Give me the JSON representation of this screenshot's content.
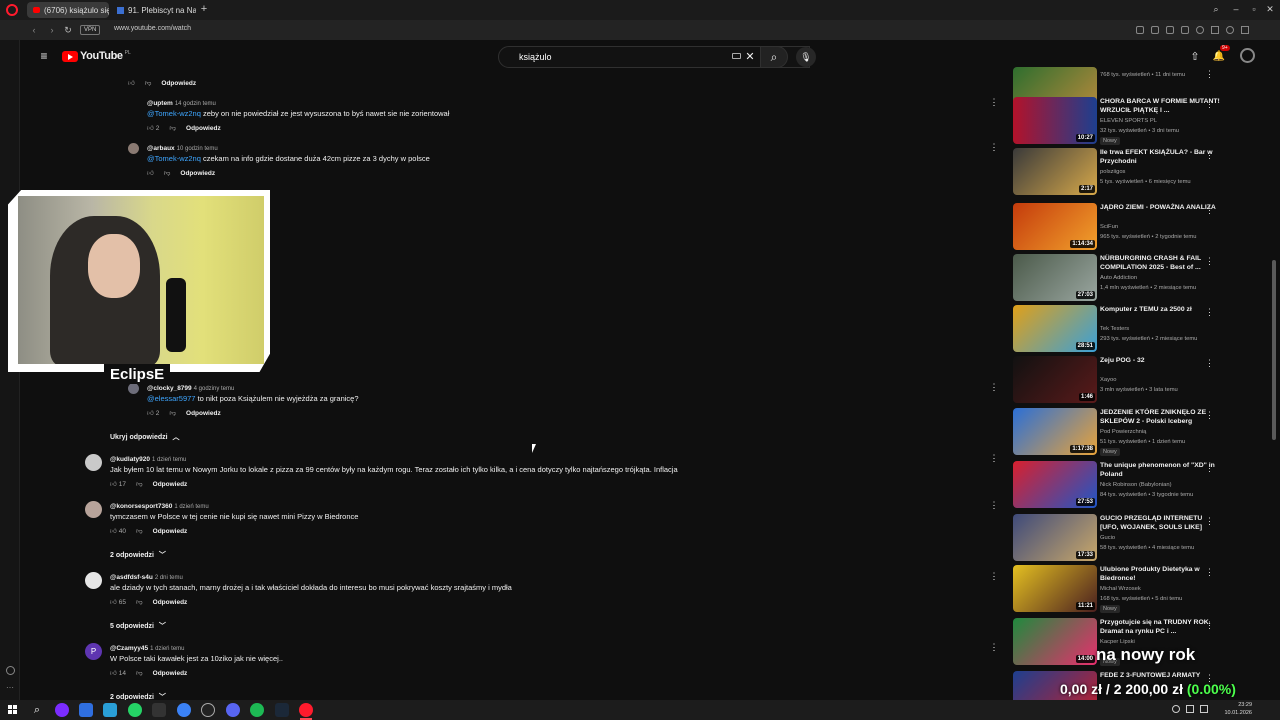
{
  "browser": {
    "tabs": [
      {
        "label": "(6706) książulo się cieszy"
      },
      {
        "label": "91. Plebiscyt na Najlepsze"
      }
    ],
    "vpn": "VPN",
    "url": "www.youtube.com/watch"
  },
  "youtube": {
    "logo": "YouTube",
    "region": "PL",
    "search_value": "książulo",
    "notif_count": "9+"
  },
  "comments": {
    "replies_top": [
      {
        "author": "",
        "time": "",
        "text": "",
        "likes": "",
        "reply": "Odpowiedz"
      },
      {
        "author": "@uptem",
        "time": "14 godzin temu",
        "mention": "@Tomek-wz2nq",
        "text": "zeby on nie powiedział ze jest wysuszona to byś nawet sie nie zorientował",
        "likes": "2",
        "reply": "Odpowiedz"
      },
      {
        "author": "@arbaux",
        "time": "10 godzin temu",
        "mention": "@Tomek-wz2nq",
        "text": "czekam na info gdzie dostane duża 42cm pizze za 3 dychy w polsce",
        "likes": "",
        "reply": "Odpowiedz"
      },
      {
        "author": "@clocky_8799",
        "time": "4 godziny temu",
        "mention": "@elessar5977",
        "text": "to nikt poza Książulem nie wyjeżdża za granicę?",
        "likes": "2",
        "reply": "Odpowiedz"
      }
    ],
    "hide_replies": "Ukryj odpowiedzi",
    "top_level": [
      {
        "author": "@kudlaty920",
        "time": "1 dzień temu",
        "text": "Jak byłem 10 lat temu w Nowym Jorku to lokale z pizza za 99 centów były na każdym rogu. Teraz zostało ich tylko kilka, a i cena dotyczy tylko najtańszego trójkąta. Inflacja",
        "likes": "17",
        "reply": "Odpowiedz",
        "replies": ""
      },
      {
        "author": "@konorsesport7360",
        "time": "1 dzień temu",
        "text": "tymczasem w Polsce w tej cenie nie kupi się nawet mini Pizzy w Biedronce",
        "likes": "40",
        "reply": "Odpowiedz",
        "replies": "2 odpowiedzi"
      },
      {
        "author": "@asdfdsf-s4u",
        "time": "2 dni temu",
        "text": "ale dziady w tych stanach, marny drożej a i tak właściciel dokłada do interesu bo musi pokrywać koszty srajtaśmy i mydła",
        "likes": "65",
        "reply": "Odpowiedz",
        "replies": "5 odpowiedzi"
      },
      {
        "author": "@Czamyy45",
        "time": "1 dzień temu",
        "text": "W Polsce taki kawałek jest za 10ziko jak nie więcej..",
        "likes": "14",
        "reply": "Odpowiedz",
        "replies": "2 odpowiedzi",
        "avatar_letter": "P"
      }
    ]
  },
  "overlay": {
    "streamer_name": "EclipsE",
    "ticker_line1": "na nowy rok",
    "ticker_value": "0,00 zł",
    "ticker_slash": "/",
    "ticker_goal": "2 200,00 zł",
    "ticker_pct": "(0.00%)"
  },
  "sidebar": {
    "videos": [
      {
        "title": "",
        "channel": "",
        "meta": "768 tys. wyświetleń • 11 dni temu",
        "duration": "29:17",
        "badge": ""
      },
      {
        "title": "CHORA BARCA W FORMIE MUTANT! WRZUCIŁ PIĄTKĘ I ...",
        "channel": "ELEVEN SPORTS PL",
        "meta": "32 tys. wyświetleń • 3 dni temu",
        "duration": "10:27",
        "badge": "Nowy"
      },
      {
        "title": "Ile trwa EFEKT KSIĄŻULA? - Bar w Przychodni",
        "channel": "polsziigos",
        "meta": "5 tys. wyświetleń • 6 miesięcy temu",
        "duration": "2:17",
        "badge": ""
      },
      {
        "title": "JĄDRO ZIEMI - POWAŻNA ANALIZA",
        "channel": "SciFun",
        "meta": "965 tys. wyświetleń • 2 tygodnie temu",
        "duration": "1:14:34",
        "badge": ""
      },
      {
        "title": "NÜRBURGRING CRASH & FAIL COMPILATION 2025 - Best of ...",
        "channel": "Auto Addiction",
        "meta": "1,4 mln wyświetleń • 2 miesiące temu",
        "duration": "27:03",
        "badge": ""
      },
      {
        "title": "Komputer z TEMU za 2500 zł",
        "channel": "Tek Testers",
        "meta": "293 tys. wyświetleń • 2 miesiące temu",
        "duration": "28:51",
        "badge": ""
      },
      {
        "title": "Zeju POG - 32",
        "channel": "Xayoo",
        "meta": "3 mln wyświetleń • 3 lata temu",
        "duration": "1:46",
        "badge": ""
      },
      {
        "title": "JEDZENIE KTÓRE ZNIKNĘŁO ZE SKLEPÓW 2 - Polski Iceberg",
        "channel": "Pod Powierzchnią",
        "meta": "51 tys. wyświetleń • 1 dzień temu",
        "duration": "1:17:38",
        "badge": "Nowy"
      },
      {
        "title": "The unique phenomenon of \"XD\" in Poland",
        "channel": "Nick Robinson (Babylonian)",
        "meta": "84 tys. wyświetleń • 3 tygodnie temu",
        "duration": "27:53",
        "badge": ""
      },
      {
        "title": "GUCIO PRZEGLĄD INTERNETU [UFO, WOJANEK, SOULS LIKE]",
        "channel": "Gucio",
        "meta": "58 tys. wyświetleń • 4 miesiące temu",
        "duration": "17:33",
        "badge": ""
      },
      {
        "title": "Ulubione Produkty Dietetyka w Biedronce!",
        "channel": "Michał Wrzosek",
        "meta": "168 tys. wyświetleń • 5 dni temu",
        "duration": "11:21",
        "badge": "Nowy"
      },
      {
        "title": "Przygotujcie się na TRUDNY ROK. Dramat na rynku PC i ...",
        "channel": "Kacper Lipski",
        "meta": "",
        "duration": "14:00",
        "badge": "Nowy"
      },
      {
        "title": "FEDE Z 3-FUNTOWEJ ARMATY",
        "channel": "",
        "meta": "",
        "duration": "",
        "badge": ""
      }
    ]
  },
  "taskbar": {
    "time": "23:29",
    "date": "10.01.2026"
  },
  "colors": {
    "bg": "#0f0f0f",
    "accent_red": "#ff0000",
    "link_blue": "#3ea6ff",
    "ticker_green": "#4cff4c"
  }
}
